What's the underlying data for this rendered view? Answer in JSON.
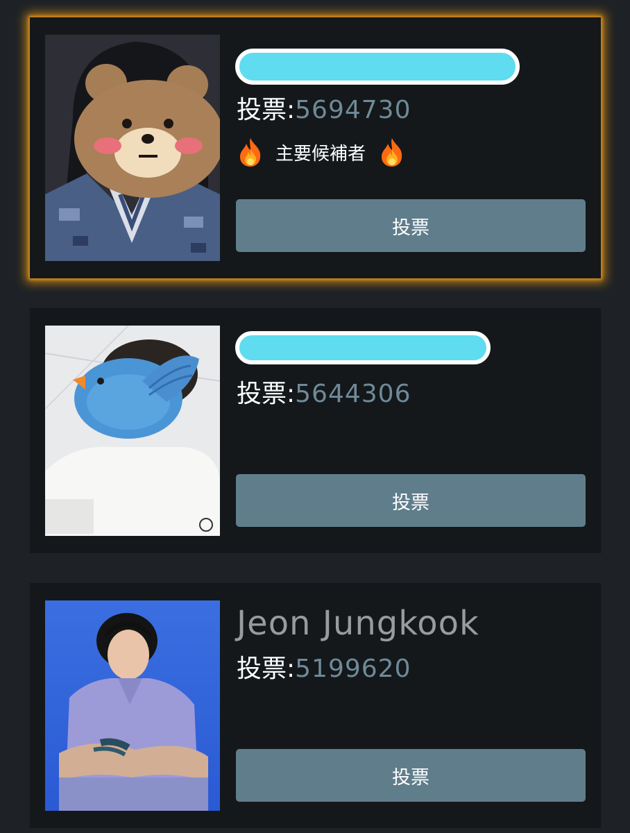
{
  "cards": [
    {
      "name": "",
      "vote_label": "投票:",
      "vote_count": "5694730",
      "candidate_badge": "主要候補者",
      "button_label": "投票",
      "highlighted": true,
      "fire_icon": "fire-emoji"
    },
    {
      "name": "",
      "vote_label": "投票:",
      "vote_count": "5644306",
      "button_label": "投票",
      "highlighted": false
    },
    {
      "name": "Jeon Jungkook",
      "vote_label": "投票:",
      "vote_count": "5199620",
      "button_label": "投票",
      "highlighted": false
    }
  ],
  "colors": {
    "page_bg": "#1e2226",
    "card_bg": "#14181b",
    "button_bg": "#607d8b",
    "vote_number": "#6f8a98",
    "highlight_glow": "#d68c14",
    "redaction": "#5fdcef"
  }
}
